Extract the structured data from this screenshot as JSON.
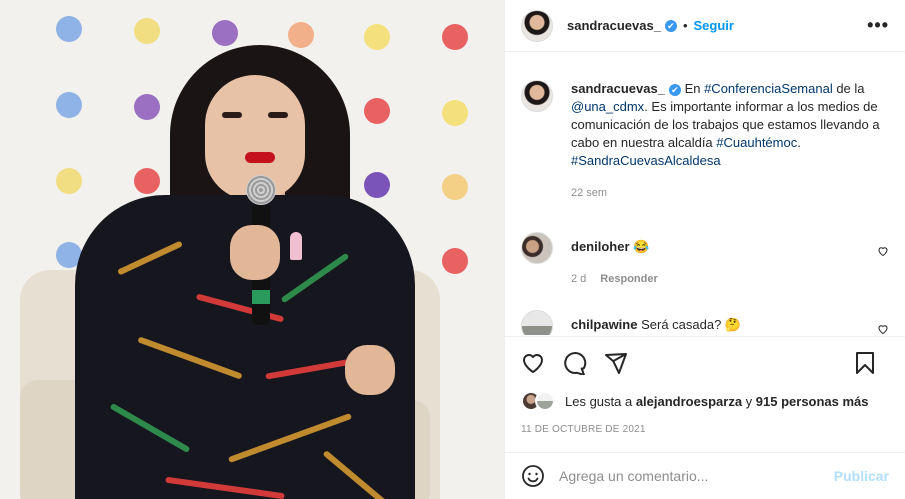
{
  "post": {
    "author": "sandracuevas_",
    "verified_mark": "✔",
    "separator": "•",
    "follow_label": "Seguir",
    "more_label": "•••"
  },
  "caption": {
    "author": "sandracuevas_",
    "segments": [
      {
        "text": " En ",
        "link": false
      },
      {
        "text": "#ConferenciaSemanal",
        "link": true
      },
      {
        "text": " de la ",
        "link": false
      },
      {
        "text": "@una_cdmx",
        "link": true
      },
      {
        "text": ". Es importante informar a los medios de comunicación de los trabajos que estamos llevando a cabo en nuestra alcaldía ",
        "link": false
      },
      {
        "text": "#Cuauhtémoc",
        "link": true
      },
      {
        "text": ". ",
        "link": false
      },
      {
        "text": "#SandraCuevasAlcaldesa",
        "link": true
      }
    ],
    "age": "22 sem"
  },
  "comments": [
    {
      "author": "deniloher",
      "text": "😂",
      "age": "2 d",
      "reply_label": "Responder"
    },
    {
      "author": "chilpawine",
      "text": "Será casada? 🤔"
    }
  ],
  "likes": {
    "prefix": "Les gusta a ",
    "user": "alejandroesparza",
    "middle": " y ",
    "count": "915 personas más"
  },
  "date": "11 DE OCTUBRE DE 2021",
  "composer": {
    "placeholder": "Agrega un comentario...",
    "publish_label": "Publicar"
  },
  "icons": [
    "heart-icon",
    "comment-icon",
    "share-icon",
    "bookmark-icon",
    "emoji-icon",
    "more-icon"
  ],
  "colors": {
    "accent": "#0095f6",
    "link": "#00376b",
    "muted": "#8e8e8e",
    "publish_disabled": "#b2dffc",
    "verified": "#3897f0"
  }
}
